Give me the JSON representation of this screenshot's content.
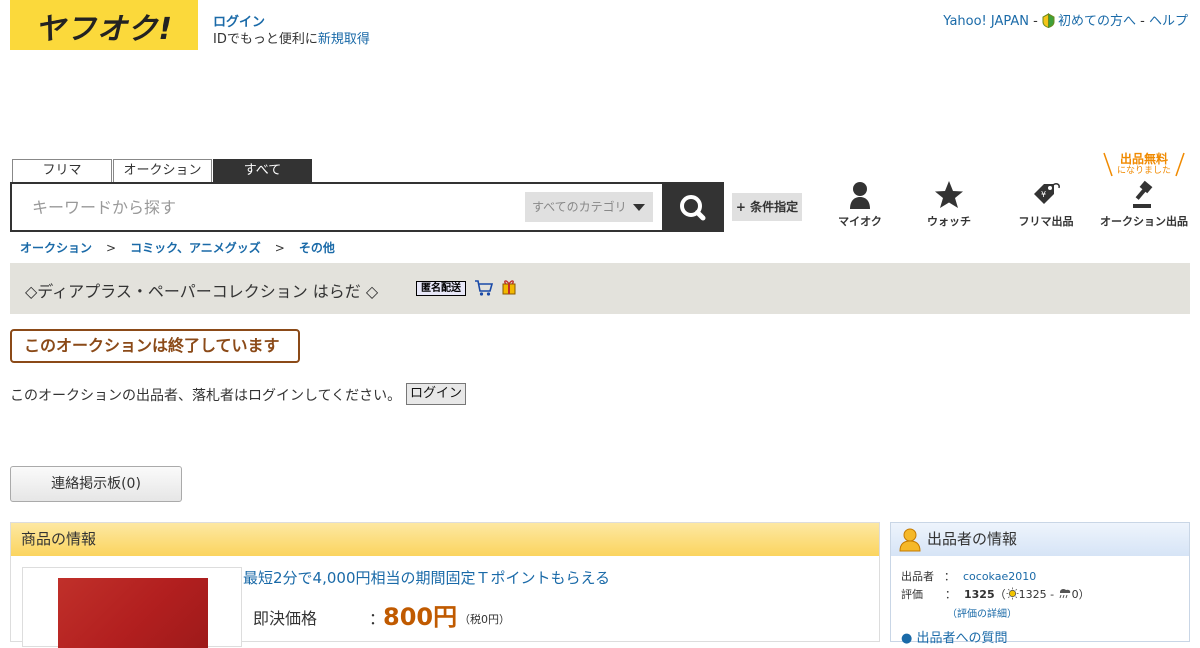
{
  "header": {
    "logo_text": "ヤフオク!",
    "login_label": "ログイン",
    "login_sub_prefix": "IDでもっと便利に",
    "signup_label": "新規取得",
    "links": {
      "yahoo_japan": "Yahoo! JAPAN",
      "sep1": " - ",
      "first_time": "初めての方へ",
      "sep2": " - ",
      "help": "ヘルプ"
    }
  },
  "tabs": [
    {
      "label": "フリマ"
    },
    {
      "label": "オークション"
    },
    {
      "label": "すべて",
      "active": true
    }
  ],
  "search": {
    "placeholder": "キーワードから探す",
    "category": "すべてのカテゴリ",
    "condition_label": "+ 条件指定"
  },
  "nav": {
    "myauc": "マイオク",
    "watch": "ウォッチ",
    "flea_sell": "フリマ出品",
    "auction_sell": "オークション出品",
    "free_badge_main": "出品無料",
    "free_badge_sub": "になりました"
  },
  "breadcrumb": {
    "items": [
      "オークション",
      "コミック、アニメグッズ",
      "その他"
    ],
    "separator": ">"
  },
  "listing": {
    "title": "◇ディアプラス・ペーパーコレクション はらだ ◇",
    "anon_badge": "匿名配送",
    "ended_message": "このオークションは終了しています",
    "login_notice": "このオークションの出品者、落札者はログインしてください。",
    "login_button": "ログイン",
    "board_button": "連絡掲示板(0)"
  },
  "item_info": {
    "header": "商品の情報",
    "promo": "最短2分で4,000円相当の期間固定Ｔポイントもらえる",
    "price_label": "即決価格",
    "price_colon": "：",
    "price_value": "800円",
    "price_tax": "（税0円）"
  },
  "seller_info": {
    "header": "出品者の情報",
    "seller_label": "出品者",
    "seller_colon": "：",
    "seller_name": "cocokae2010",
    "rating_label": "評価",
    "rating_colon": "：",
    "rating_value": "1325",
    "rating_paren_open": "（",
    "good_count": "1325",
    "rating_dash": " - ",
    "bad_count": "0",
    "rating_paren_close": "）",
    "rating_detail": "（評価の詳細）",
    "bottom_text": "● 出品者への質問"
  },
  "colors": {
    "logo_yellow": "#fbd93b",
    "link_blue": "#1a6aa8",
    "price_orange": "#c05a00",
    "ended_brown": "#8b4a18",
    "title_bar_bg": "#e3e2dc",
    "free_badge_orange": "#f08a00"
  }
}
